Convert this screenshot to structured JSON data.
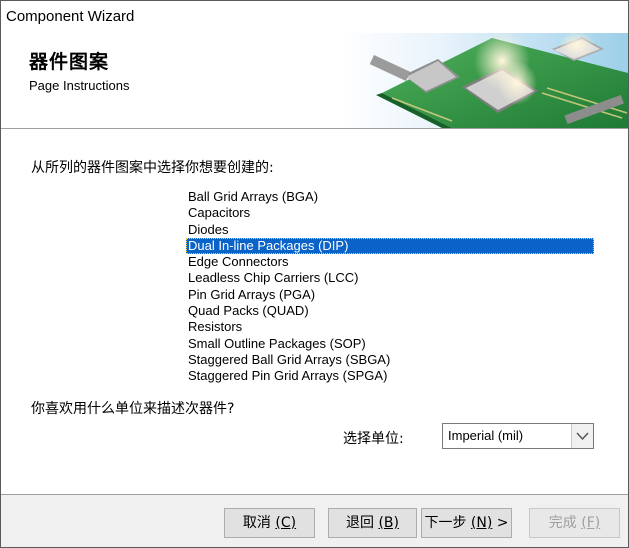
{
  "window": {
    "title": "Component Wizard"
  },
  "header": {
    "title": "器件图案",
    "subtitle": "Page Instructions"
  },
  "main": {
    "prompt_pattern": "从所列的器件图案中选择你想要创建的:",
    "patterns": [
      "Ball Grid Arrays (BGA)",
      "Capacitors",
      "Diodes",
      "Dual In-line Packages (DIP)",
      "Edge Connectors",
      "Leadless Chip Carriers (LCC)",
      "Pin Grid Arrays (PGA)",
      "Quad Packs (QUAD)",
      "Resistors",
      "Small Outline Packages (SOP)",
      "Staggered Ball Grid Arrays (SBGA)",
      "Staggered Pin Grid Arrays (SPGA)"
    ],
    "selected_pattern": "Dual In-line Packages (DIP)",
    "prompt_units": "你喜欢用什么单位来描述次器件?",
    "unit_label": "选择单位:",
    "unit_value": "Imperial (mil)"
  },
  "footer": {
    "cancel": {
      "label": "取消 ",
      "accel": "(C)"
    },
    "back": {
      "label": "退回 ",
      "accel": "(B)"
    },
    "next": {
      "label": "下一步 ",
      "accel": "(N)",
      "suffix": " >"
    },
    "finish": {
      "label": "完成 ",
      "accel": "(F)"
    }
  },
  "colors": {
    "selection": "#0a63c9",
    "footer_bg": "#f0f0f0",
    "banner_pcb": "#2f9a45"
  },
  "icons": {
    "combo_arrow": "chevron-down-icon",
    "banner": "pcb-chip-banner-image"
  }
}
